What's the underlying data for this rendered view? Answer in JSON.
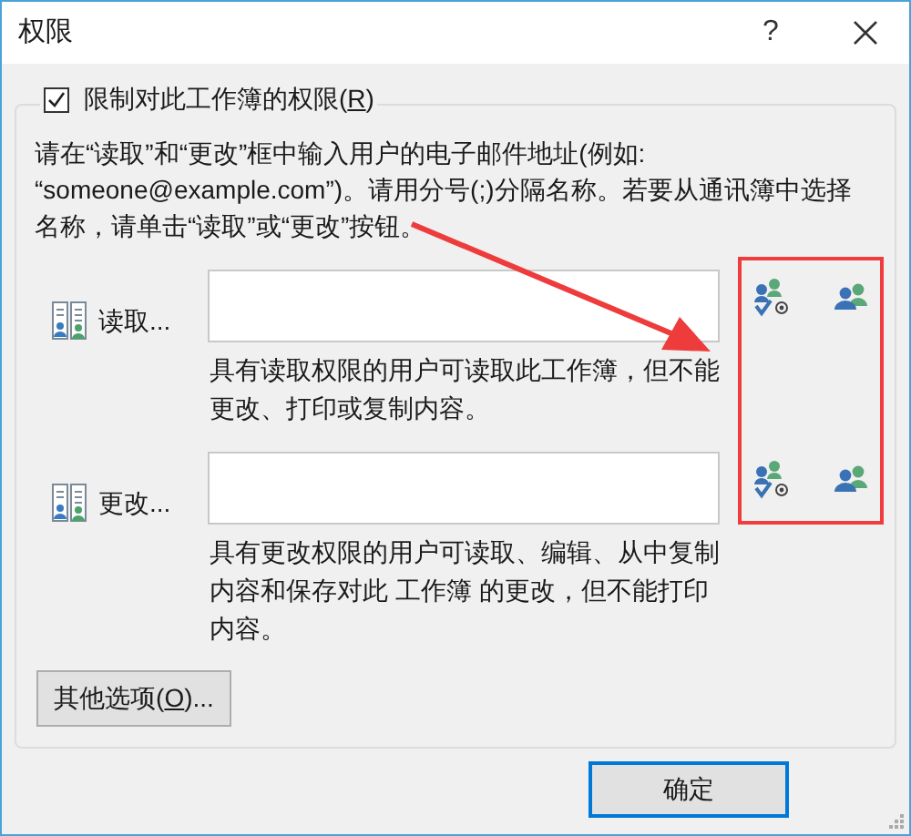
{
  "window": {
    "title": "权限",
    "help": "?"
  },
  "restrict": {
    "checked": true,
    "label_before": "限制对此工作簿的权限(",
    "access_key": "R",
    "label_after": ")"
  },
  "instructions_lines": [
    "请在“读取”和“更改”框中输入用户的电子邮件地址(例如:",
    "“someone@example.com”)。请用分号(;)分隔名称。若要从通讯簿中选择",
    "名称，请单击“读取”或“更改”按钮。"
  ],
  "permissions": [
    {
      "label": "读取...",
      "description_lines": [
        "具有读取权限的用户可读取此工作簿，但不能",
        "更改、打印或复制内容。"
      ]
    },
    {
      "label": "更改...",
      "description_lines": [
        "具有更改权限的用户可读取、编辑、从中复制",
        "内容和保存对此 工作簿 的更改，但不能打印",
        "内容。"
      ]
    }
  ],
  "other_options": {
    "before": "其他选项(",
    "access_key": "O",
    "after": ")..."
  },
  "ok_button": "确定",
  "annotation": {
    "arrow": true,
    "highlight_frame": true
  }
}
